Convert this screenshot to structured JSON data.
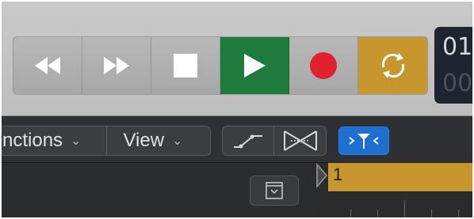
{
  "transport": {
    "buttons": [
      {
        "name": "rewind-button",
        "icon": "rewind-icon"
      },
      {
        "name": "fast-forward-button",
        "icon": "fast-forward-icon"
      },
      {
        "name": "stop-button",
        "icon": "stop-icon"
      },
      {
        "name": "play-button",
        "icon": "play-icon",
        "color": "#1f7a3e"
      },
      {
        "name": "record-button",
        "icon": "record-icon",
        "color": "#e0202c"
      },
      {
        "name": "cycle-button",
        "icon": "cycle-icon",
        "color": "#c8962e"
      }
    ]
  },
  "lcd": {
    "top_text": "01",
    "bottom_text": "00"
  },
  "toolbar": {
    "functions_label": "nctions",
    "view_label": "View",
    "automation_icon": "automation-curve-icon",
    "crossfade_icon": "crossfade-icon",
    "catch_icon": "catch-playhead-icon",
    "catch_color": "#1f6fd1"
  },
  "tracks": {
    "collapse_icon": "collapse-tracks-icon",
    "ruler": {
      "bar_label": "1",
      "cycle_color": "#c8962e"
    }
  }
}
